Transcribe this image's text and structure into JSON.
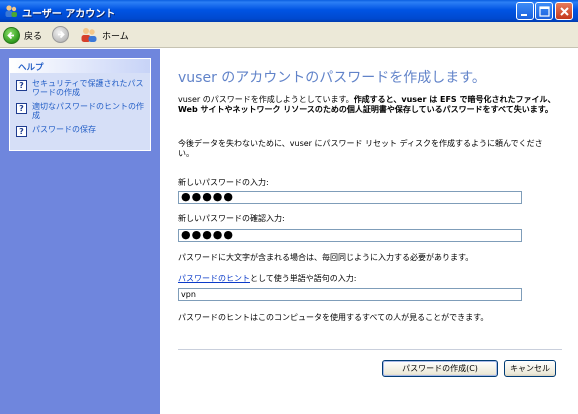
{
  "window": {
    "title": "ユーザー アカウント",
    "controls": [
      "minimize",
      "maximize",
      "close"
    ]
  },
  "toolbar": {
    "back_label": "戻る",
    "home_label": "ホーム"
  },
  "sidebar": {
    "help_title": "ヘルプ",
    "items": [
      {
        "label": "セキュリティで保護されたパスワードの作成",
        "icon": "help-icon"
      },
      {
        "label": "適切なパスワードのヒントの作成",
        "icon": "help-icon"
      },
      {
        "label": "パスワードの保存",
        "icon": "help-icon"
      }
    ]
  },
  "main": {
    "heading": "vuser のアカウントのパスワードを作成します。",
    "intro_plain": "vuser のパスワードを作成しようとしています。",
    "intro_bold": "作成すると、vuser は EFS で暗号化されたファイル、Web サイトやネットワーク リソースのための個人証明書や保存しているパスワードをすべて失います。",
    "reset_note": "今後データを失わないために、vuser にパスワード リセット ディスクを作成するように頼んでください。",
    "new_password_label": "新しいパスワードの入力:",
    "new_password_value": "●●●●●",
    "confirm_password_label": "新しいパスワードの確認入力:",
    "confirm_password_value": "●●●●●",
    "case_note": "パスワードに大文字が含まれる場合は、毎回同じように入力する必要があります。",
    "hint_link": "パスワードのヒント",
    "hint_label_rest": "として使う単語や語句の入力:",
    "hint_value": "vpn",
    "hint_note": "パスワードのヒントはこのコンピュータを使用するすべての人が見ることができます。",
    "create_button": "パスワードの作成(C)",
    "cancel_button": "キャンセル"
  },
  "colors": {
    "titlebar": "#0054e3",
    "sidebar": "#6f86dd",
    "heading": "#6183c9",
    "link": "#215dc6"
  }
}
